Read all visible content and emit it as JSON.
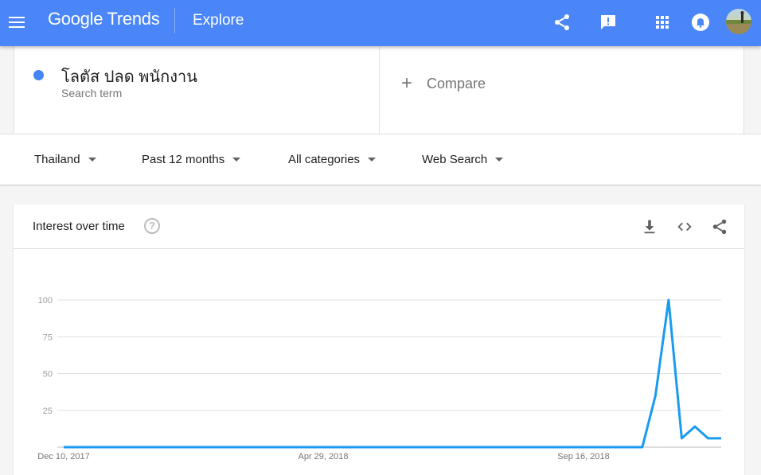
{
  "header": {
    "logo": "Google Trends",
    "section": "Explore",
    "icons": [
      "menu-icon",
      "share-icon",
      "feedback-icon",
      "apps-icon",
      "notifications-icon",
      "avatar"
    ]
  },
  "search_term": {
    "name": "โลตัส ปลด พนักงาน",
    "subtitle": "Search term",
    "color": "#4285f4"
  },
  "compare": {
    "label": "Compare"
  },
  "filters": {
    "region": "Thailand",
    "time": "Past 12 months",
    "category": "All categories",
    "search_type": "Web Search"
  },
  "chart_card": {
    "title": "Interest over time",
    "help": "?"
  },
  "chart_data": {
    "type": "line",
    "title": "Interest over time",
    "xlabel": "",
    "ylabel": "",
    "ylim": [
      0,
      100
    ],
    "y_ticks": [
      25,
      50,
      75,
      100
    ],
    "x_tick_labels": [
      "Dec 10, 2017",
      "Apr 29, 2018",
      "Sep 16, 2018"
    ],
    "grid": true,
    "series_color": "#1a9bef",
    "series": [
      {
        "values": [
          0,
          0,
          0,
          0,
          0,
          0,
          0,
          0,
          0,
          0,
          0,
          0,
          0,
          0,
          0,
          0,
          0,
          0,
          0,
          0,
          0,
          0,
          0,
          0,
          0,
          0,
          0,
          0,
          0,
          0,
          0,
          0,
          0,
          0,
          0,
          0,
          0,
          0,
          0,
          0,
          0,
          0,
          0,
          0,
          0,
          35,
          100,
          6,
          14,
          6,
          6
        ]
      }
    ]
  }
}
